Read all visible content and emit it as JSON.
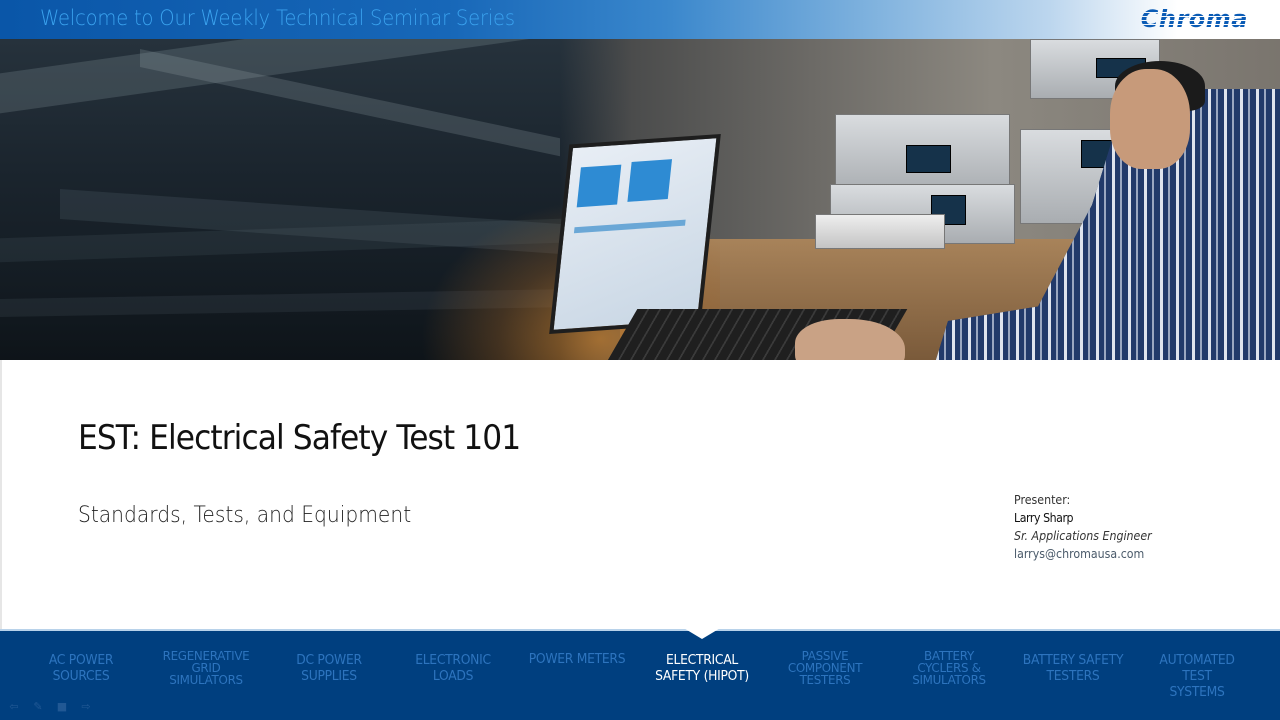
{
  "header": {
    "title": "Welcome to Our Weekly Technical Seminar Series",
    "logo_text": "Chroma"
  },
  "slide": {
    "title": "EST: Electrical Safety Test 101",
    "subtitle": "Standards, Tests, and Equipment"
  },
  "presenter": {
    "label": "Presenter:",
    "name": "Larry Sharp",
    "role": "Sr. Applications Engineer",
    "email": "larrys@chromausa.com"
  },
  "nav": {
    "active_index": 5,
    "items": [
      {
        "label": "AC POWER\nSOURCES"
      },
      {
        "label": "REGENERATIVE\nGRID\nSIMULATORS"
      },
      {
        "label": "DC POWER\nSUPPLIES"
      },
      {
        "label": "ELECTRONIC\nLOADS"
      },
      {
        "label": "POWER METERS"
      },
      {
        "label": "ELECTRICAL\nSAFETY (HIPOT)"
      },
      {
        "label": "PASSIVE\nCOMPONENT\nTESTERS"
      },
      {
        "label": "BATTERY\nCYCLERS &\nSIMULATORS"
      },
      {
        "label": "BATTERY SAFETY\nTESTERS"
      },
      {
        "label": "AUTOMATED\nTEST SYSTEMS"
      }
    ]
  },
  "player_controls": {
    "icons": [
      "back-arrow-icon",
      "pen-icon",
      "screen-icon",
      "forward-arrow-icon"
    ],
    "glyphs": [
      "⇦",
      "✎",
      "■",
      "⇨"
    ]
  },
  "colors": {
    "header_blue": "#0a56a8",
    "header_text": "#3aa2ee",
    "nav_bg": "#003f7f",
    "nav_text": "#2d74be",
    "nav_active": "#ffffff"
  }
}
